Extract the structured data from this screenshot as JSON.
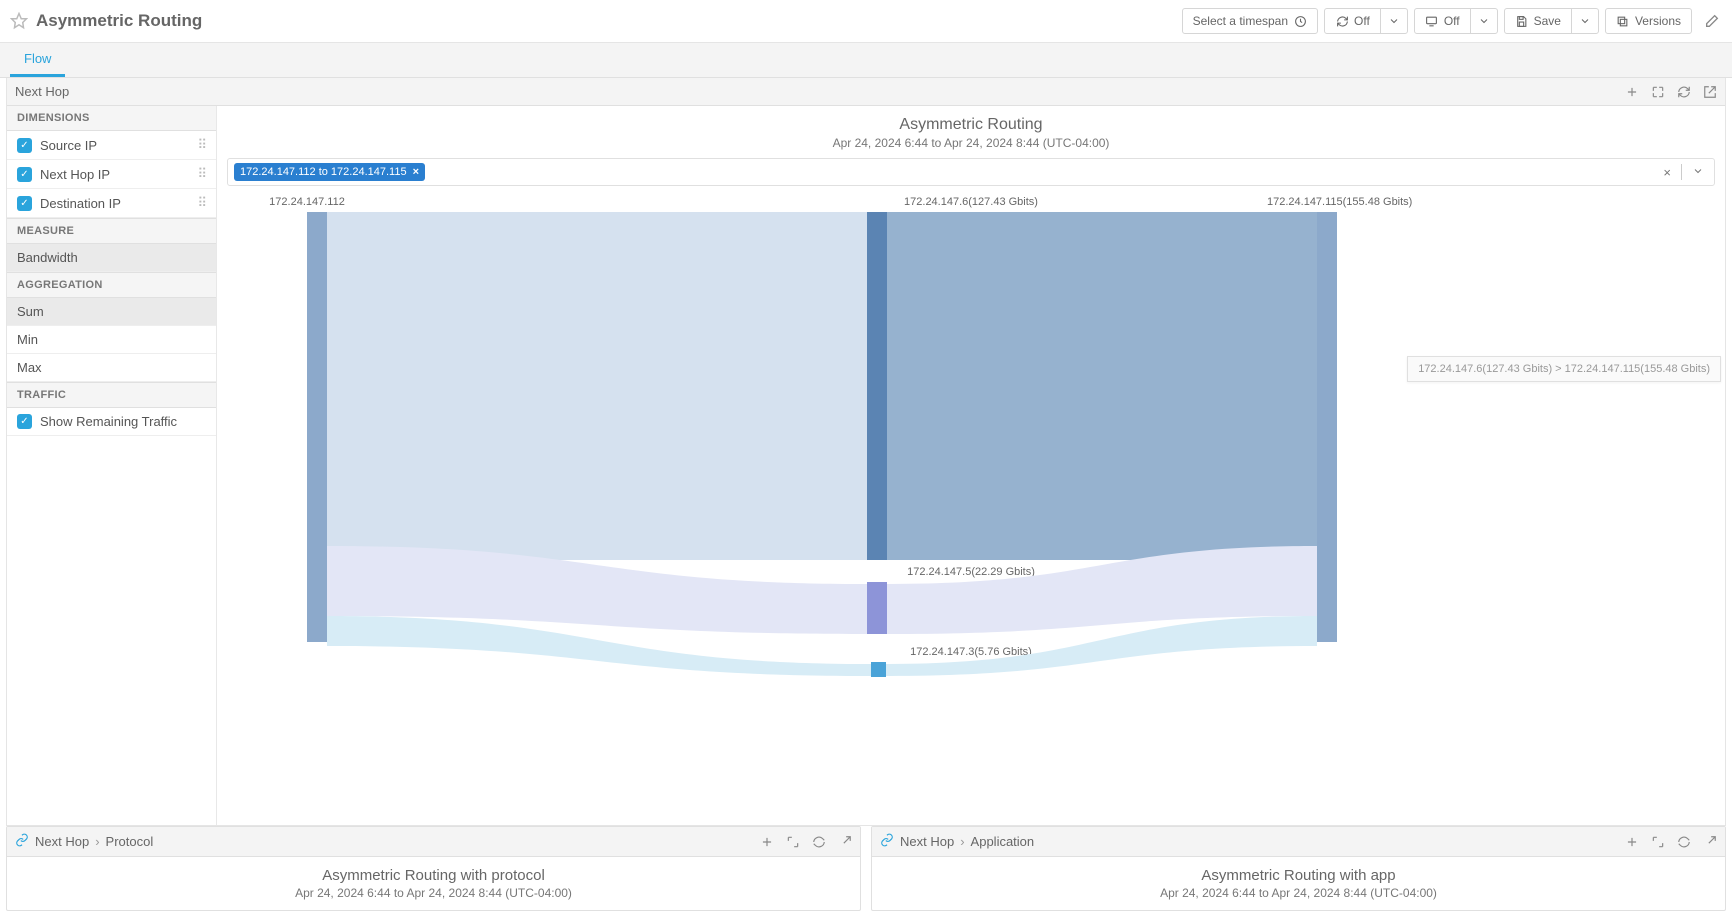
{
  "header": {
    "title": "Asymmetric Routing",
    "timespan_btn": "Select a timespan",
    "refresh_off": "Off",
    "live_off": "Off",
    "save": "Save",
    "versions": "Versions"
  },
  "tabs": {
    "flow": "Flow"
  },
  "panel1": {
    "title": "Next Hop"
  },
  "sidebar": {
    "dimensions_h": "DIMENSIONS",
    "dim1": "Source IP",
    "dim2": "Next Hop IP",
    "dim3": "Destination IP",
    "measure_h": "MEASURE",
    "measure1": "Bandwidth",
    "agg_h": "AGGREGATION",
    "agg1": "Sum",
    "agg2": "Min",
    "agg3": "Max",
    "traffic_h": "TRAFFIC",
    "traffic1": "Show Remaining Traffic"
  },
  "chart": {
    "title": "Asymmetric Routing",
    "subtitle": "Apr 24, 2024 6:44 to Apr 24, 2024 8:44 (UTC-04:00)",
    "filter_chip": "172.24.147.112 to 172.24.147.115",
    "labels": {
      "src": "172.24.147.112",
      "h6": "172.24.147.6(127.43 Gbits)",
      "h5": "172.24.147.5(22.29 Gbits)",
      "h3": "172.24.147.3(5.76 Gbits)",
      "dst": "172.24.147.115(155.48 Gbits)"
    },
    "tooltip": "172.24.147.6(127.43 Gbits) > 172.24.147.115(155.48 Gbits)"
  },
  "bottom": {
    "left": {
      "crumb1": "Next Hop",
      "crumb2": "Protocol",
      "title": "Asymmetric Routing with protocol",
      "sub": "Apr 24, 2024 6:44 to Apr 24, 2024 8:44 (UTC-04:00)"
    },
    "right": {
      "crumb1": "Next Hop",
      "crumb2": "Application",
      "title": "Asymmetric Routing with app",
      "sub": "Apr 24, 2024 6:44 to Apr 24, 2024 8:44 (UTC-04:00)"
    }
  },
  "chart_data": {
    "type": "sankey",
    "title": "Asymmetric Routing",
    "time_range": "Apr 24, 2024 6:44 to Apr 24, 2024 8:44 (UTC-04:00)",
    "unit": "Gbits",
    "nodes": [
      {
        "id": "172.24.147.112",
        "stage": "source"
      },
      {
        "id": "172.24.147.6",
        "stage": "nexthop",
        "value": 127.43
      },
      {
        "id": "172.24.147.5",
        "stage": "nexthop",
        "value": 22.29
      },
      {
        "id": "172.24.147.3",
        "stage": "nexthop",
        "value": 5.76
      },
      {
        "id": "172.24.147.115",
        "stage": "destination",
        "value": 155.48
      }
    ],
    "links": [
      {
        "source": "172.24.147.112",
        "target": "172.24.147.6",
        "value": 127.43
      },
      {
        "source": "172.24.147.112",
        "target": "172.24.147.5",
        "value": 22.29
      },
      {
        "source": "172.24.147.112",
        "target": "172.24.147.3",
        "value": 5.76
      },
      {
        "source": "172.24.147.6",
        "target": "172.24.147.115",
        "value": 127.43
      },
      {
        "source": "172.24.147.5",
        "target": "172.24.147.115",
        "value": 22.29
      },
      {
        "source": "172.24.147.3",
        "target": "172.24.147.115",
        "value": 5.76
      }
    ]
  }
}
